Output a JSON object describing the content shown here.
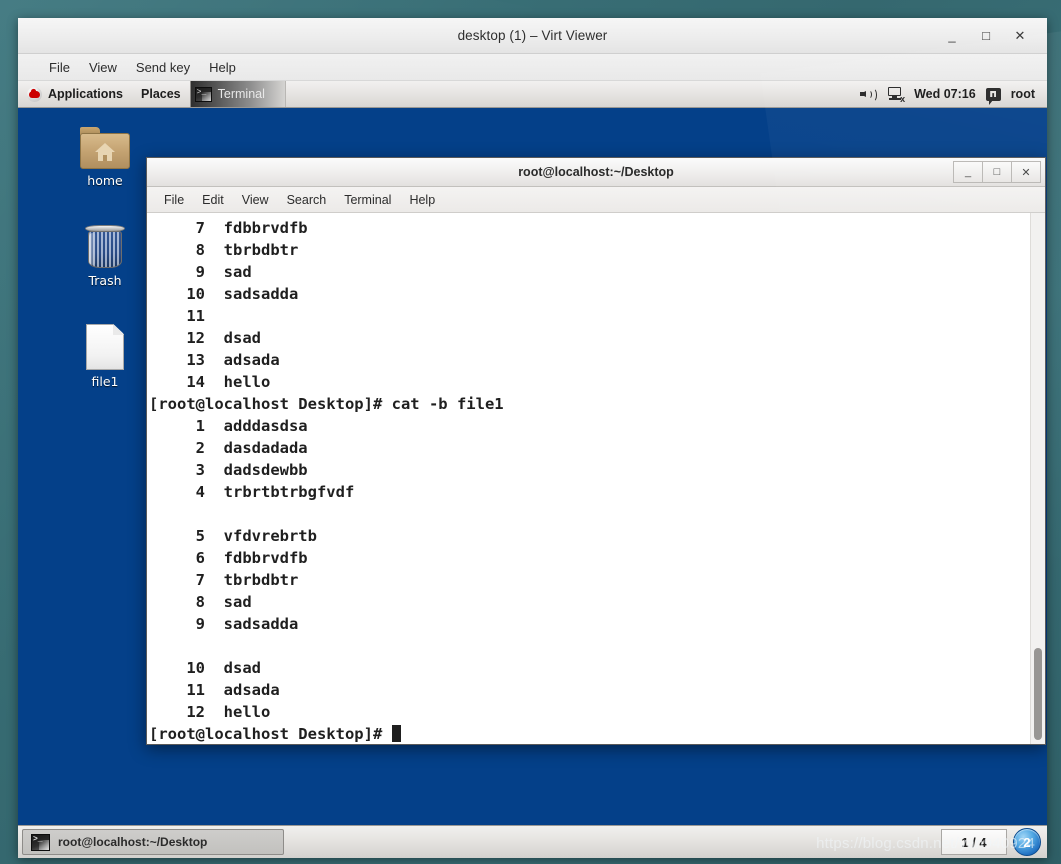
{
  "viewer": {
    "title": "desktop (1) – Virt Viewer",
    "window_controls": {
      "minimize": "_",
      "maximize": "□",
      "close": "✕"
    },
    "menus": [
      "File",
      "View",
      "Send key",
      "Help"
    ]
  },
  "gnome_panel": {
    "applications_label": "Applications",
    "places_label": "Places",
    "window_button_label": "Terminal",
    "clock": "Wed 07:16",
    "user": "root",
    "icons": {
      "logo": "redhat-logo-icon",
      "window": "terminal-icon",
      "volume": "volume-icon",
      "network": "network-disconnected-icon",
      "user": "chat-user-icon"
    }
  },
  "desktop": {
    "background_color": "#044089",
    "icons": [
      {
        "label": "home",
        "icon": "home-folder-icon"
      },
      {
        "label": "Trash",
        "icon": "trash-icon"
      },
      {
        "label": "file1",
        "icon": "text-file-icon"
      }
    ]
  },
  "terminal": {
    "title": "root@localhost:~/Desktop",
    "menus": [
      "File",
      "Edit",
      "View",
      "Search",
      "Terminal",
      "Help"
    ],
    "window_controls": {
      "minimize": "_",
      "maximize": "□",
      "close": "✕"
    },
    "lines": [
      "     7  fdbbrvdfb",
      "     8  tbrbdbtr",
      "     9  sad",
      "    10  sadsadda",
      "    11",
      "    12  dsad",
      "    13  adsada",
      "    14  hello",
      "[root@localhost Desktop]# cat -b file1",
      "     1  adddasdsa",
      "     2  dasdadada",
      "     3  dadsdewbb",
      "     4  trbrtbtrbgfvdf",
      "",
      "     5  vfdvrebrtb",
      "     6  fdbbrvdfb",
      "     7  tbrbdbtr",
      "     8  sad",
      "     9  sadsadda",
      "",
      "    10  dsad",
      "    11  adsada",
      "    12  hello"
    ],
    "prompt": "[root@localhost Desktop]# "
  },
  "taskbar": {
    "task_label": "root@localhost:~/Desktop",
    "task_icon": "terminal-icon",
    "workspace_indicator": "1 / 4",
    "notification_badge": "2"
  },
  "watermark": "https://blog.csdn.net/yan940924"
}
